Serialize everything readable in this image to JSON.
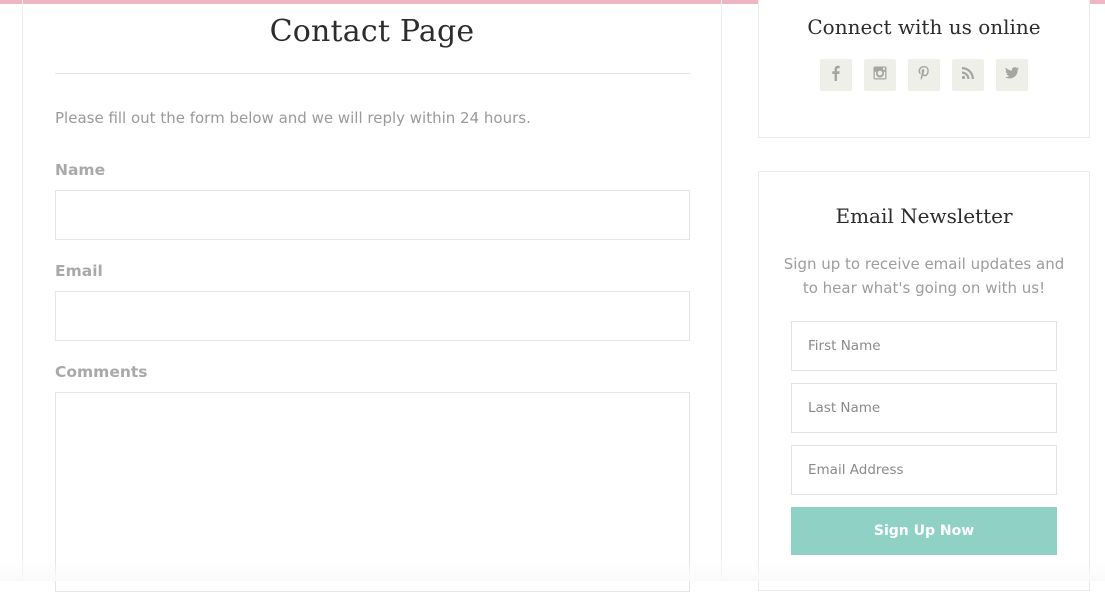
{
  "page": {
    "title": "Contact Page",
    "intro": "Please fill out the form below and we will reply within 24 hours."
  },
  "form": {
    "name_label": "Name",
    "name_value": "",
    "email_label": "Email",
    "email_value": "",
    "comments_label": "Comments",
    "comments_value": ""
  },
  "social": {
    "title": "Connect with us online",
    "icons": [
      "facebook-icon",
      "instagram-icon",
      "pinterest-icon",
      "rss-icon",
      "twitter-icon"
    ]
  },
  "newsletter": {
    "title": "Email Newsletter",
    "description": "Sign up to receive email updates and to hear what's going on with us!",
    "first_name_placeholder": "First Name",
    "last_name_placeholder": "Last Name",
    "email_placeholder": "Email Address",
    "button_label": "Sign Up Now"
  },
  "colors": {
    "top_bar": "#eeb6c0",
    "button": "#8fd1c4",
    "social_bg": "#efefea"
  }
}
